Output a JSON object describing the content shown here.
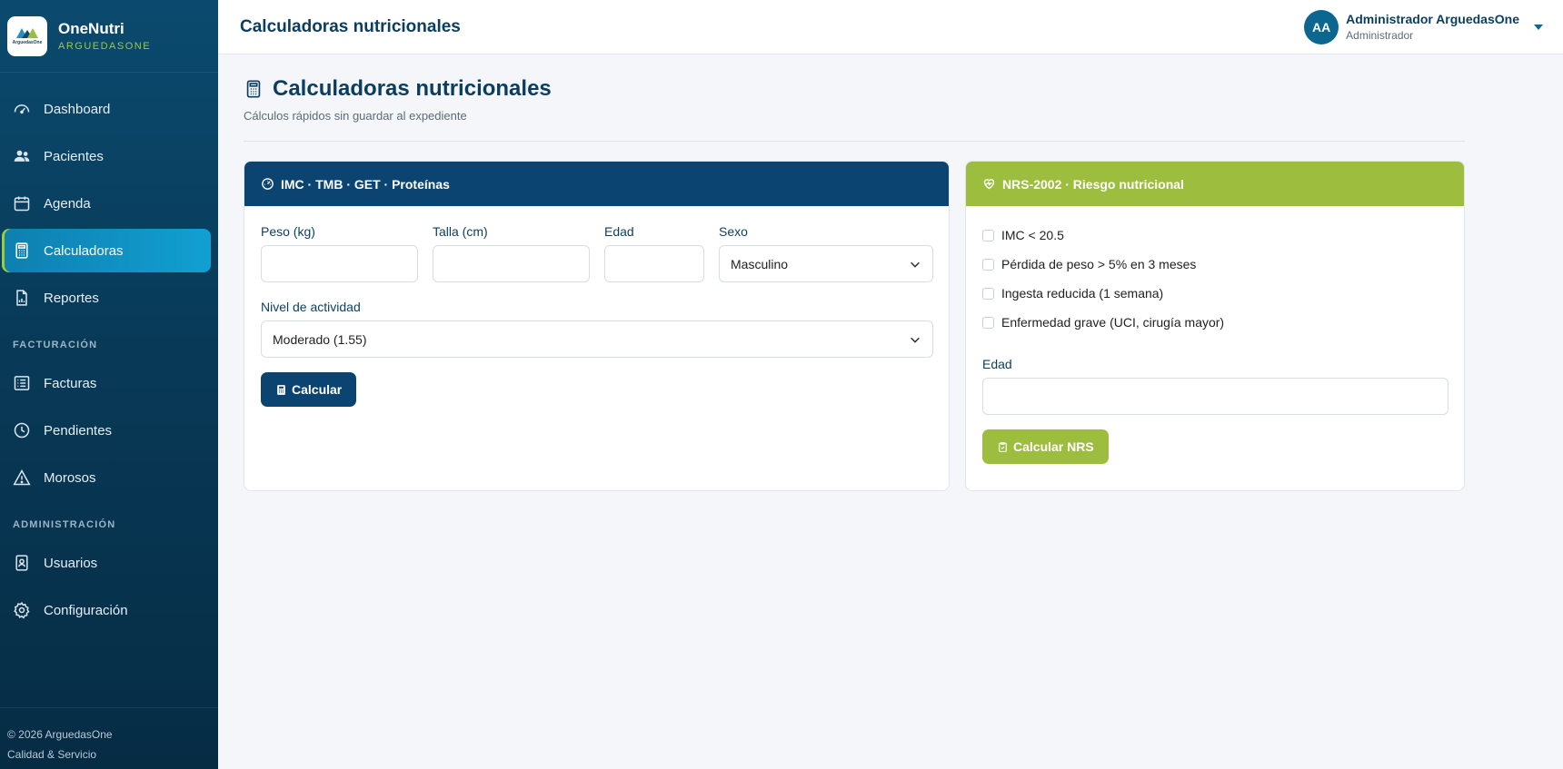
{
  "brand": {
    "name": "OneNutri",
    "subtitle": "ARGUEDASONE",
    "logo_text": "ArguedasOne"
  },
  "sidebar": {
    "items": [
      {
        "label": "Dashboard",
        "icon": "gauge-icon"
      },
      {
        "label": "Pacientes",
        "icon": "users-icon"
      },
      {
        "label": "Agenda",
        "icon": "calendar-icon"
      },
      {
        "label": "Calculadoras",
        "icon": "calculator-icon",
        "active": true
      },
      {
        "label": "Reportes",
        "icon": "report-icon"
      }
    ],
    "section_billing": "FACTURACIÓN",
    "billing_items": [
      {
        "label": "Facturas",
        "icon": "invoice-icon"
      },
      {
        "label": "Pendientes",
        "icon": "clock-icon"
      },
      {
        "label": "Morosos",
        "icon": "warning-icon"
      }
    ],
    "section_admin": "ADMINISTRACIÓN",
    "admin_items": [
      {
        "label": "Usuarios",
        "icon": "id-badge-icon"
      },
      {
        "label": "Configuración",
        "icon": "gear-icon"
      }
    ],
    "footer_line1": "© 2026 ArguedasOne",
    "footer_line2": "Calidad & Servicio"
  },
  "header": {
    "title": "Calculadoras nutricionales",
    "user_initials": "AA",
    "user_name": "Administrador ArguedasOne",
    "user_role": "Administrador"
  },
  "page": {
    "title": "Calculadoras nutricionales",
    "subtitle": "Cálculos rápidos sin guardar al expediente"
  },
  "calc_card": {
    "title": "IMC · TMB · GET · Proteínas",
    "weight_label": "Peso (kg)",
    "weight_value": "",
    "height_label": "Talla (cm)",
    "height_value": "",
    "age_label": "Edad",
    "age_value": "",
    "sex_label": "Sexo",
    "sex_value": "Masculino",
    "activity_label": "Nivel de actividad",
    "activity_value": "Moderado (1.55)",
    "button": "Calcular"
  },
  "nrs_card": {
    "title": "NRS-2002 · Riesgo nutricional",
    "checks": [
      "IMC < 20.5",
      "Pérdida de peso > 5% en 3 meses",
      "Ingesta reducida (1 semana)",
      "Enfermedad grave (UCI, cirugía mayor)"
    ],
    "age_label": "Edad",
    "age_value": "",
    "button": "Calcular NRS"
  },
  "colors": {
    "sidebar": "#0b4a6e",
    "active": "#11a0d2",
    "primary": "#0b4470",
    "accent": "#9dbd3e"
  }
}
